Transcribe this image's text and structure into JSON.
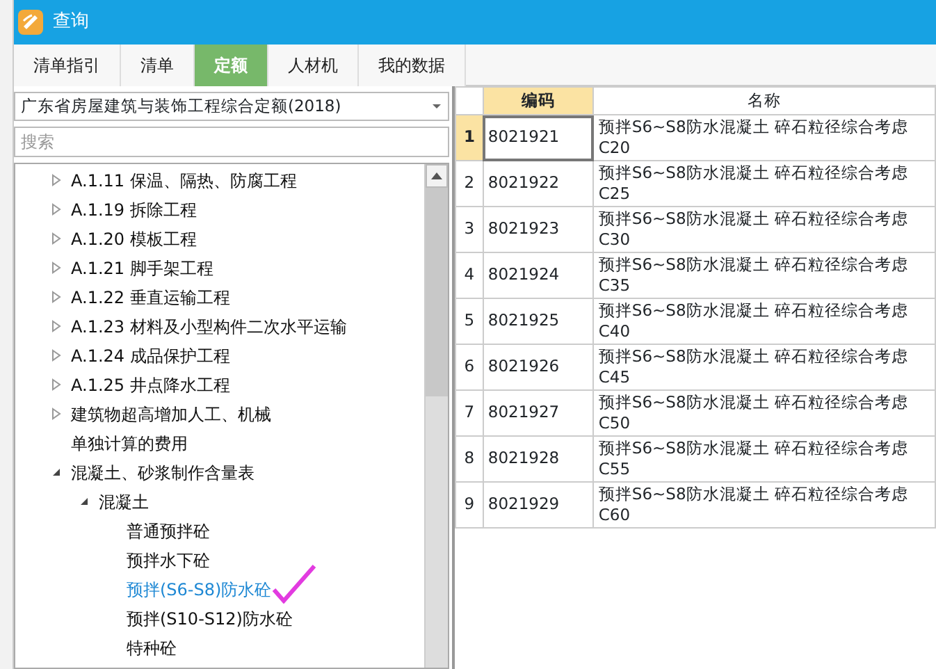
{
  "window": {
    "title": "查询"
  },
  "tabs": [
    {
      "label": "清单指引",
      "selected": false
    },
    {
      "label": "清单",
      "selected": false
    },
    {
      "label": "定额",
      "selected": true
    },
    {
      "label": "人材机",
      "selected": false
    },
    {
      "label": "我的数据",
      "selected": false
    }
  ],
  "library_dropdown": {
    "value": "广东省房屋建筑与装饰工程综合定额(2018)"
  },
  "search": {
    "placeholder": "搜索"
  },
  "tree": [
    {
      "label": "A.1.11 保温、隔热、防腐工程",
      "expanded": false,
      "selected": false
    },
    {
      "label": "A.1.19 拆除工程",
      "expanded": false,
      "selected": false
    },
    {
      "label": "A.1.20 模板工程",
      "expanded": false,
      "selected": false
    },
    {
      "label": "A.1.21 脚手架工程",
      "expanded": false,
      "selected": false
    },
    {
      "label": "A.1.22 垂直运输工程",
      "expanded": false,
      "selected": false
    },
    {
      "label": "A.1.23 材料及小型构件二次水平运输",
      "expanded": false,
      "selected": false
    },
    {
      "label": "A.1.24 成品保护工程",
      "expanded": false,
      "selected": false
    },
    {
      "label": "A.1.25 井点降水工程",
      "expanded": false,
      "selected": false
    },
    {
      "label": "建筑物超高增加人工、机械",
      "expanded": false,
      "selected": false
    },
    {
      "label": "单独计算的费用",
      "selected": false
    },
    {
      "label": "混凝土、砂浆制作含量表",
      "expanded": true,
      "selected": false,
      "children": [
        {
          "label": "混凝土",
          "expanded": true,
          "selected": false,
          "children": [
            {
              "label": "普通预拌砼",
              "selected": false
            },
            {
              "label": "预拌水下砼",
              "selected": false
            },
            {
              "label": "预拌(S6-S8)防水砼",
              "selected": true
            },
            {
              "label": "预拌(S10-S12)防水砼",
              "selected": false
            },
            {
              "label": "特种砼",
              "selected": false
            }
          ]
        }
      ]
    }
  ],
  "table": {
    "columns": [
      "编码",
      "名称"
    ],
    "rows": [
      {
        "row_number": "1",
        "code": "8021921",
        "name": "预拌S6~S8防水混凝土  碎石粒径综合考虑\nC20",
        "selected": true
      },
      {
        "row_number": "2",
        "code": "8021922",
        "name": "预拌S6~S8防水混凝土  碎石粒径综合考虑\nC25",
        "selected": false
      },
      {
        "row_number": "3",
        "code": "8021923",
        "name": "预拌S6~S8防水混凝土  碎石粒径综合考虑\nC30",
        "selected": false
      },
      {
        "row_number": "4",
        "code": "8021924",
        "name": "预拌S6~S8防水混凝土  碎石粒径综合考虑\nC35",
        "selected": false
      },
      {
        "row_number": "5",
        "code": "8021925",
        "name": "预拌S6~S8防水混凝土  碎石粒径综合考虑\nC40",
        "selected": false
      },
      {
        "row_number": "6",
        "code": "8021926",
        "name": "预拌S6~S8防水混凝土  碎石粒径综合考虑\nC45",
        "selected": false
      },
      {
        "row_number": "7",
        "code": "8021927",
        "name": "预拌S6~S8防水混凝土  碎石粒径综合考虑\nC50",
        "selected": false
      },
      {
        "row_number": "8",
        "code": "8021928",
        "name": "预拌S6~S8防水混凝土  碎石粒径综合考虑\nC55",
        "selected": false
      },
      {
        "row_number": "9",
        "code": "8021929",
        "name": "预拌S6~S8防水混凝土  碎石粒径综合考虑\nC60",
        "selected": false
      }
    ]
  }
}
